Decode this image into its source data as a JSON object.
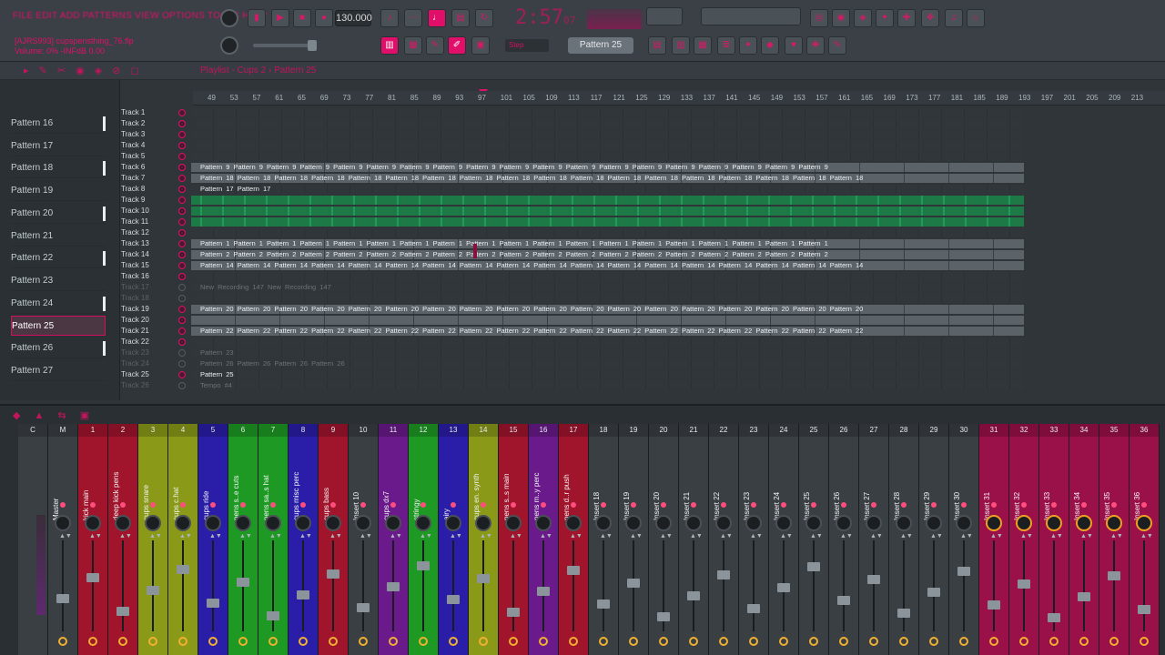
{
  "top": {
    "menu": "FILE EDIT ADD PATTERNS VIEW OPTIONS TOOLS HELP",
    "project_hint": "[AJRS993] cupspensthing_76.flp",
    "volume_hint": "Volume: 0%  -INFdB  0.00",
    "tempo": "130.000",
    "time": "2:57",
    "time_sub": "07",
    "snap": "Step",
    "pattern": "Pattern 25"
  },
  "playlist": {
    "title": "Playlist - Cups 2 › Pattern 25",
    "ruler": [
      "49",
      "53",
      "57",
      "61",
      "65",
      "69",
      "73",
      "77",
      "81",
      "85",
      "89",
      "93",
      "97",
      "101",
      "105",
      "109",
      "113",
      "117",
      "121",
      "125",
      "129",
      "133",
      "137",
      "141",
      "145",
      "149",
      "153",
      "157",
      "161",
      "165",
      "169",
      "173",
      "177",
      "181",
      "185",
      "189",
      "193",
      "197",
      "201",
      "205",
      "209",
      "213"
    ],
    "picker": [
      "Pattern 16",
      "Pattern 17",
      "Pattern 18",
      "Pattern 19",
      "Pattern 20",
      "Pattern 21",
      "Pattern 22",
      "Pattern 23",
      "Pattern 24",
      "Pattern 25",
      "Pattern 26",
      "Pattern 27"
    ],
    "picker_selected": "Pattern 25",
    "tracks": [
      {
        "name": "Track 1",
        "lane": "",
        "kind": "empty"
      },
      {
        "name": "Track 2",
        "lane": "",
        "kind": "empty"
      },
      {
        "name": "Track 3",
        "lane": "",
        "kind": "empty"
      },
      {
        "name": "Track 4",
        "lane": "",
        "kind": "empty"
      },
      {
        "name": "Track 5",
        "lane": "",
        "kind": "empty"
      },
      {
        "name": "Track 6",
        "lane": "Pattern 9  Pattern 9  Pattern 9  Pattern 9  Pattern 9  Pattern 9  Pattern 9  Pattern 9  Pattern 9  Pattern 9  Pattern 9  Pattern 9  Pattern 9  Pattern 9  Pattern 9  Pattern 9  Pattern 9  Pattern 9  Pattern 9",
        "kind": "blocks"
      },
      {
        "name": "Track 7",
        "lane": "Pattern 18  Pattern 18  Pattern 18  Pattern 18  Pattern 18  Pattern 18  Pattern 18  Pattern 18  Pattern 18  Pattern 18  Pattern 18  Pattern 18  Pattern 18  Pattern 18  Pattern 18  Pattern 18  Pattern 18  Pattern 18",
        "kind": "blocks"
      },
      {
        "name": "Track 8",
        "lane": "Pattern 17                                                                  Pattern 17",
        "kind": "empty"
      },
      {
        "name": "Track 9",
        "lane": "",
        "kind": "green"
      },
      {
        "name": "Track 10",
        "lane": "",
        "kind": "green"
      },
      {
        "name": "Track 11",
        "lane": "",
        "kind": "green"
      },
      {
        "name": "Track 12",
        "lane": "",
        "kind": "empty"
      },
      {
        "name": "Track 13",
        "lane": "Pattern 1  Pattern 1  Pattern 1  Pattern 1  Pattern 1  Pattern 1  Pattern 1  Pattern 1  Pattern 1  Pattern 1  Pattern 1  Pattern 1  Pattern 1  Pattern 1  Pattern 1  Pattern 1  Pattern 1  Pattern 1  Pattern 1",
        "kind": "blocks"
      },
      {
        "name": "Track 14",
        "lane": "Pattern 2  Pattern 2  Pattern 2  Pattern 2  Pattern 2  Pattern 2  Pattern 2  Pattern 2  Pattern 2  Pattern 2  Pattern 2  Pattern 2  Pattern 2  Pattern 2  Pattern 2  Pattern 2  Pattern 2  Pattern 2  Pattern 2",
        "kind": "blocks"
      },
      {
        "name": "Track 15",
        "lane": "Pattern 14  Pattern 14  Pattern 14  Pattern 14  Pattern 14  Pattern 14  Pattern 14  Pattern 14  Pattern 14  Pattern 14  Pattern 14  Pattern 14  Pattern 14  Pattern 14  Pattern 14  Pattern 14  Pattern 14  Pattern 14",
        "kind": "blocks"
      },
      {
        "name": "Track 16",
        "lane": "",
        "kind": "empty"
      },
      {
        "name": "Track 17",
        "lane": "New Recording 147                                                      New Recording 147",
        "kind": "empty",
        "dim": true
      },
      {
        "name": "Track 18",
        "lane": "",
        "kind": "empty",
        "dim": true
      },
      {
        "name": "Track 19",
        "lane": "Pattern 20  Pattern 20  Pattern 20  Pattern 20  Pattern 20  Pattern 20  Pattern 20  Pattern 20  Pattern 20  Pattern 20  Pattern 20  Pattern 20  Pattern 20  Pattern 20  Pattern 20  Pattern 20  Pattern 20  Pattern 20",
        "kind": "blocks"
      },
      {
        "name": "Track 20",
        "lane": "",
        "kind": "blocks"
      },
      {
        "name": "Track 21",
        "lane": "Pattern 22  Pattern 22  Pattern 22  Pattern 22  Pattern 22  Pattern 22  Pattern 22  Pattern 22  Pattern 22  Pattern 22  Pattern 22  Pattern 22  Pattern 22  Pattern 22  Pattern 22  Pattern 22  Pattern 22  Pattern 22",
        "kind": "blocks"
      },
      {
        "name": "Track 22",
        "lane": "",
        "kind": "empty"
      },
      {
        "name": "Track 23",
        "lane": "Pattern 23",
        "kind": "empty",
        "dim": true
      },
      {
        "name": "Track 24",
        "lane": "            Pattern 26                                            Pattern 26                                          Pattern 26                                          Pattern 26",
        "kind": "empty",
        "dim": true
      },
      {
        "name": "Track 25",
        "lane": "Pattern 25",
        "kind": "empty"
      },
      {
        "name": "Track 26",
        "lane": "Tempo #4",
        "kind": "empty",
        "dim": true
      }
    ]
  },
  "mixer": {
    "strips": [
      {
        "num": "C",
        "name": "",
        "color": "#3a3f44"
      },
      {
        "num": "M",
        "name": "Master",
        "color": "#3a3f44"
      },
      {
        "num": "1",
        "name": "kick main",
        "color": "#a0142c"
      },
      {
        "num": "2",
        "name": "deep kick pens",
        "color": "#a0142c"
      },
      {
        "num": "3",
        "name": "cups snare",
        "color": "#8a9a18"
      },
      {
        "num": "4",
        "name": "cups c.hat",
        "color": "#8a9a18"
      },
      {
        "num": "5",
        "name": "cups ride",
        "color": "#2a1ea8"
      },
      {
        "num": "6",
        "name": "pens s..e cuts",
        "color": "#1e9a24"
      },
      {
        "num": "7",
        "name": "pens sa..s hat",
        "color": "#1e9a24"
      },
      {
        "num": "8",
        "name": "cups misc perc",
        "color": "#2a1ea8"
      },
      {
        "num": "9",
        "name": "cups bass",
        "color": "#a0142c"
      },
      {
        "num": "10",
        "name": "Insert 10",
        "color": "#3a3f44"
      },
      {
        "num": "11",
        "name": "cups dx7",
        "color": "#6a1a8a"
      },
      {
        "num": "12",
        "name": "stringy",
        "color": "#1e9a24"
      },
      {
        "num": "13",
        "name": "airy",
        "color": "#2a1ea8"
      },
      {
        "num": "14",
        "name": "cups en. synth",
        "color": "#8a9a18"
      },
      {
        "num": "15",
        "name": "pens s..s main",
        "color": "#a0142c"
      },
      {
        "num": "16",
        "name": "pens m..y perc",
        "color": "#6a1a8a"
      },
      {
        "num": "17",
        "name": "pens d..r push",
        "color": "#a0142c"
      },
      {
        "num": "18",
        "name": "Insert 18",
        "color": "#3a3f44"
      },
      {
        "num": "19",
        "name": "Insert 19",
        "color": "#3a3f44"
      },
      {
        "num": "20",
        "name": "Insert 20",
        "color": "#3a3f44"
      },
      {
        "num": "21",
        "name": "Insert 21",
        "color": "#3a3f44"
      },
      {
        "num": "22",
        "name": "Insert 22",
        "color": "#3a3f44"
      },
      {
        "num": "23",
        "name": "Insert 23",
        "color": "#3a3f44"
      },
      {
        "num": "24",
        "name": "Insert 24",
        "color": "#3a3f44"
      },
      {
        "num": "25",
        "name": "Insert 25",
        "color": "#3a3f44"
      },
      {
        "num": "26",
        "name": "Insert 26",
        "color": "#3a3f44"
      },
      {
        "num": "27",
        "name": "Insert 27",
        "color": "#3a3f44"
      },
      {
        "num": "28",
        "name": "Insert 28",
        "color": "#3a3f44"
      },
      {
        "num": "29",
        "name": "Insert 29",
        "color": "#3a3f44"
      },
      {
        "num": "30",
        "name": "Insert 30",
        "color": "#3a3f44"
      },
      {
        "num": "31",
        "name": "Insert 31",
        "color": "#9a1048"
      },
      {
        "num": "32",
        "name": "Insert 32",
        "color": "#9a1048"
      },
      {
        "num": "33",
        "name": "Insert 33",
        "color": "#9a1048"
      },
      {
        "num": "34",
        "name": "Insert 34",
        "color": "#9a1048"
      },
      {
        "num": "35",
        "name": "Insert 35",
        "color": "#9a1048"
      },
      {
        "num": "36",
        "name": "Insert 36",
        "color": "#9a1048"
      }
    ]
  }
}
